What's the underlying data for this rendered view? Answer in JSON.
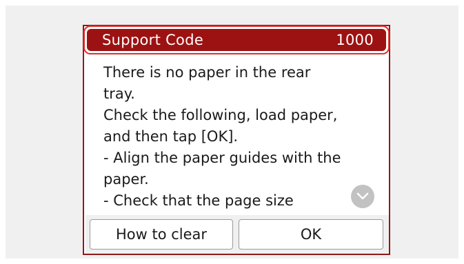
{
  "dialog": {
    "header": {
      "label": "Support Code",
      "code": "1000"
    },
    "message_lines": "There is no paper in the rear\ntray.\nCheck the following, load paper,\nand then tap [OK].\n- Align the paper guides with the\npaper.\n- Check that the page size",
    "scroll_icon": "chevron-down-icon",
    "buttons": {
      "how_to_clear": "How to clear",
      "ok": "OK"
    }
  },
  "colors": {
    "header_bg": "#9c1212",
    "header_outline": "#e0312b",
    "dialog_border": "#8e1a1a",
    "screen_bg": "#f0f0f0",
    "scroll_button": "#c2c2c2"
  }
}
